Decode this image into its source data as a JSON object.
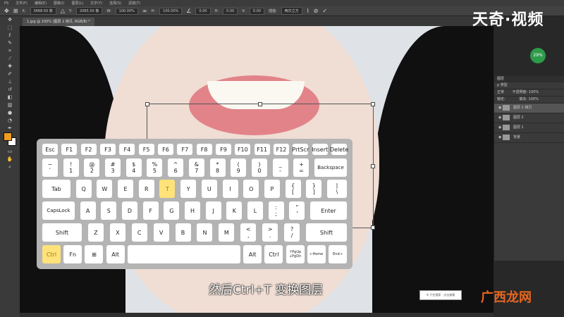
{
  "menu": {
    "items": [
      "PS",
      "文件(F)",
      "编辑(E)",
      "图像(I)",
      "图层(L)",
      "文字(Y)",
      "选择(S)",
      "滤镜(T)"
    ]
  },
  "options": {
    "x_label": "X:",
    "x_value": "3668.50 像",
    "y_label": "Y:",
    "y_value": "2065.50 像",
    "w_label": "W:",
    "w_value": "100.00%",
    "h_label": "H:",
    "h_value": "100.00%",
    "angle": "0.00",
    "h_skew_label": "H:",
    "h_skew": "0.00",
    "v_skew_label": "V:",
    "v_skew": "0.00",
    "interp_label": "插值:",
    "interp_value": "两次立方"
  },
  "logo": {
    "text": "天奇·视频"
  },
  "document": {
    "tab_label": "1.jpg @ 100% (图层 2 拷贝, RGB/8) *"
  },
  "badge": {
    "text": "29%"
  },
  "layers_panel": {
    "title": "图层",
    "filter_label": "ρ 类型",
    "blend_mode": "正常",
    "opacity_label": "不透明度: 100%",
    "lock_label": "锁定:",
    "fill_label": "填充: 100%",
    "layers": [
      {
        "name": "图层 2 拷贝",
        "selected": true
      },
      {
        "name": "图层 2",
        "selected": false
      },
      {
        "name": "图层 1",
        "selected": false
      },
      {
        "name": "背景",
        "selected": false
      }
    ]
  },
  "keyboard": {
    "highlight_color": "#ffe27a",
    "rows": [
      [
        "Esc",
        "F1",
        "F2",
        "F3",
        "F4",
        "F5",
        "F6",
        "F7",
        "F8",
        "F9",
        "F10",
        "F11",
        "F12",
        "PrtScr",
        "Insert",
        "Delete"
      ],
      [
        "~\n`",
        "!\n1",
        "@\n2",
        "#\n3",
        "$\n4",
        "%\n5",
        "^\n6",
        "&\n7",
        "*\n8",
        "(\n9",
        ")\n0",
        "_\n-",
        "+\n=",
        "Backspace"
      ],
      [
        "Tab",
        "Q",
        "W",
        "E",
        "R",
        "T",
        "Y",
        "U",
        "I",
        "O",
        "P",
        "{\n[",
        "}\n]",
        "|\n\\"
      ],
      [
        "CapsLock",
        "A",
        "S",
        "D",
        "F",
        "G",
        "H",
        "J",
        "K",
        "L",
        ":\n;",
        "\"\n'",
        "Enter"
      ],
      [
        "Shift",
        "Z",
        "X",
        "C",
        "V",
        "B",
        "N",
        "M",
        "<\n,",
        ">\n.",
        "?\n/",
        "Shift"
      ],
      [
        "Ctrl",
        "Fn",
        "⊞",
        "Alt",
        "",
        "Alt",
        "Ctrl",
        "↑PgUp\n↓PgDn",
        "←Home",
        "End→"
      ]
    ],
    "highlighted": [
      "Ctrl",
      "T"
    ]
  },
  "subtitle": {
    "text": "然后Ctrl+T 变换图层"
  },
  "tooltip": {
    "text": "※ 只往搜索 · 点击查看"
  },
  "watermark": {
    "text": "广西龙网"
  }
}
